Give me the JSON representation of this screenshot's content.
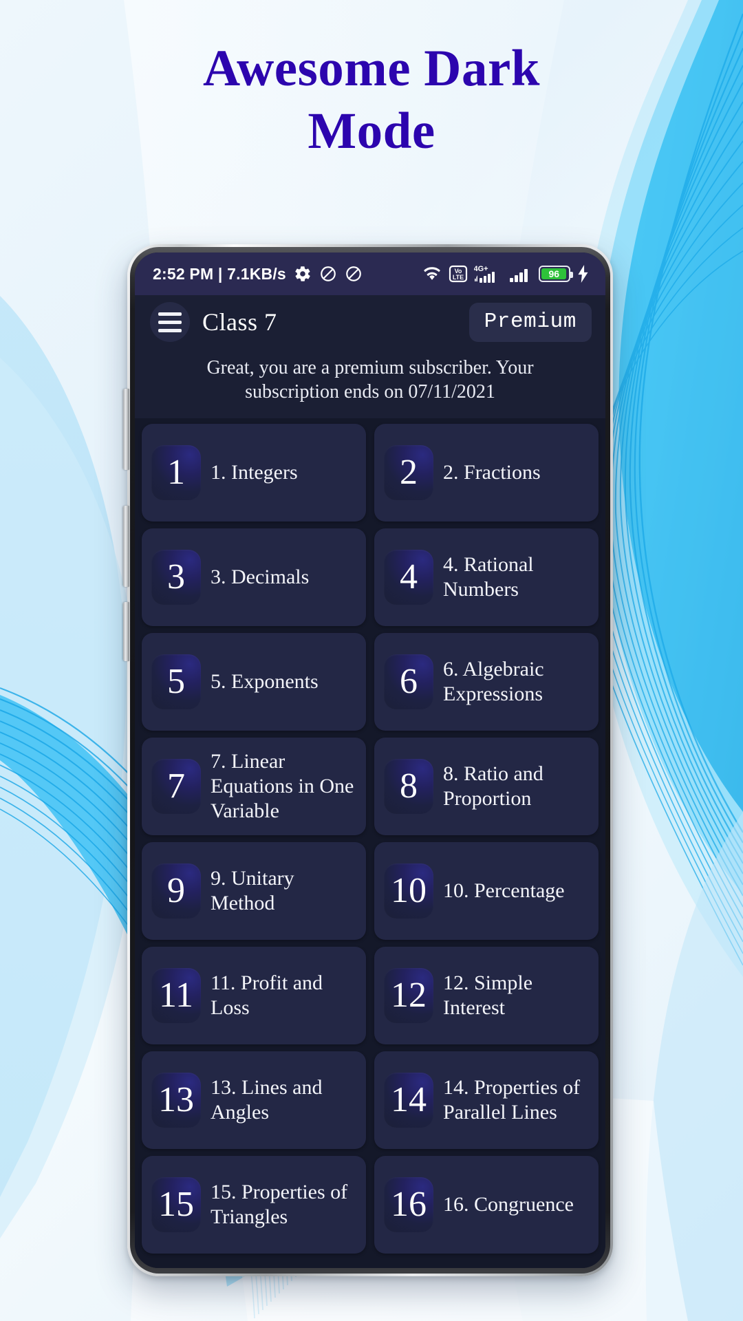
{
  "headline": {
    "line1": "Awesome Dark",
    "line2": "Mode"
  },
  "colors": {
    "headline": "#2c05ae",
    "status_bar_bg": "#2b2a52",
    "app_bar_bg": "#1b1f34",
    "screen_bg": "#141829",
    "card_bg": "#232745",
    "battery_green": "#2ec23a",
    "accent_wave": "#29ace3"
  },
  "status_bar": {
    "clock": "2:52 PM | 7.1KB/s",
    "left_icons": [
      "gear-icon",
      "do-not-disturb-icon",
      "do-not-disturb-icon"
    ],
    "right_icons": [
      "wifi-icon",
      "volte-icon",
      "signal-4gplus-icon",
      "signal-icon"
    ],
    "volte_label_top": "Vo",
    "volte_label_bottom": "LTE",
    "network_label": "4G+",
    "battery_level": "96",
    "charging": true
  },
  "app_bar": {
    "menu_icon": "hamburger-menu-icon",
    "title": "Class  7",
    "premium_label": "Premium"
  },
  "subscription": {
    "message": "Great, you are a premium subscriber. Your subscription ends on  07/11/2021"
  },
  "chapters": [
    {
      "num": "1",
      "label": "1. Integers"
    },
    {
      "num": "2",
      "label": "2. Fractions"
    },
    {
      "num": "3",
      "label": "3. Decimals"
    },
    {
      "num": "4",
      "label": "4. Rational Numbers"
    },
    {
      "num": "5",
      "label": "5. Exponents"
    },
    {
      "num": "6",
      "label": "6. Algebraic Expressions"
    },
    {
      "num": "7",
      "label": "7. Linear Equations in One Variable"
    },
    {
      "num": "8",
      "label": "8. Ratio and Proportion"
    },
    {
      "num": "9",
      "label": "9. Unitary Method"
    },
    {
      "num": "10",
      "label": "10. Percentage"
    },
    {
      "num": "11",
      "label": "11. Profit and Loss"
    },
    {
      "num": "12",
      "label": "12. Simple Interest"
    },
    {
      "num": "13",
      "label": "13. Lines and Angles"
    },
    {
      "num": "14",
      "label": "14. Properties of Parallel Lines"
    },
    {
      "num": "15",
      "label": "15. Properties of Triangles"
    },
    {
      "num": "16",
      "label": "16. Congruence"
    }
  ]
}
